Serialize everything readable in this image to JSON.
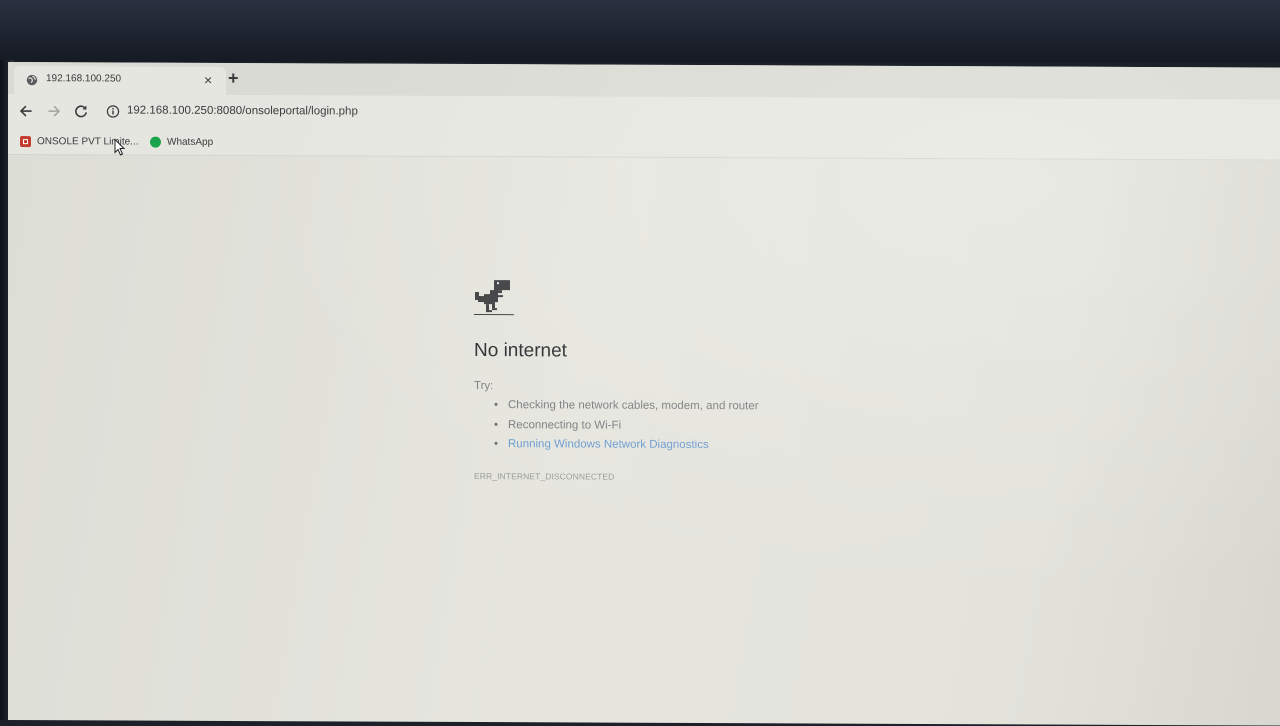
{
  "browser": {
    "tab": {
      "title": "192.168.100.250",
      "favicon": "globe-icon",
      "close_glyph": "×"
    },
    "new_tab_glyph": "+",
    "toolbar": {
      "back_icon": "arrow-left-icon",
      "forward_icon": "arrow-right-icon",
      "reload_icon": "reload-icon",
      "site_info_icon": "info-icon",
      "url": "192.168.100.250:8080/onsoleportal/login.php"
    },
    "bookmarks": [
      {
        "label": "ONSOLE PVT Limite...",
        "icon": "onsole-favicon"
      },
      {
        "label": "WhatsApp",
        "icon": "whatsapp-icon"
      }
    ]
  },
  "error_page": {
    "icon": "dinosaur-icon",
    "heading": "No internet",
    "try_label": "Try:",
    "suggestions": [
      {
        "text": "Checking the network cables, modem, and router",
        "is_link": false
      },
      {
        "text": "Reconnecting to Wi-Fi",
        "is_link": false
      },
      {
        "text": "Running Windows Network Diagnostics",
        "is_link": true
      }
    ],
    "bullet_glyph": "•",
    "error_code": "ERR_INTERNET_DISCONNECTED"
  },
  "colors": {
    "link": "#6b9bd0",
    "heading": "#2b2c2e",
    "muted_text": "#7c7d7f",
    "chrome_bar": "#e5e6df",
    "bezel": "#1b2029"
  }
}
